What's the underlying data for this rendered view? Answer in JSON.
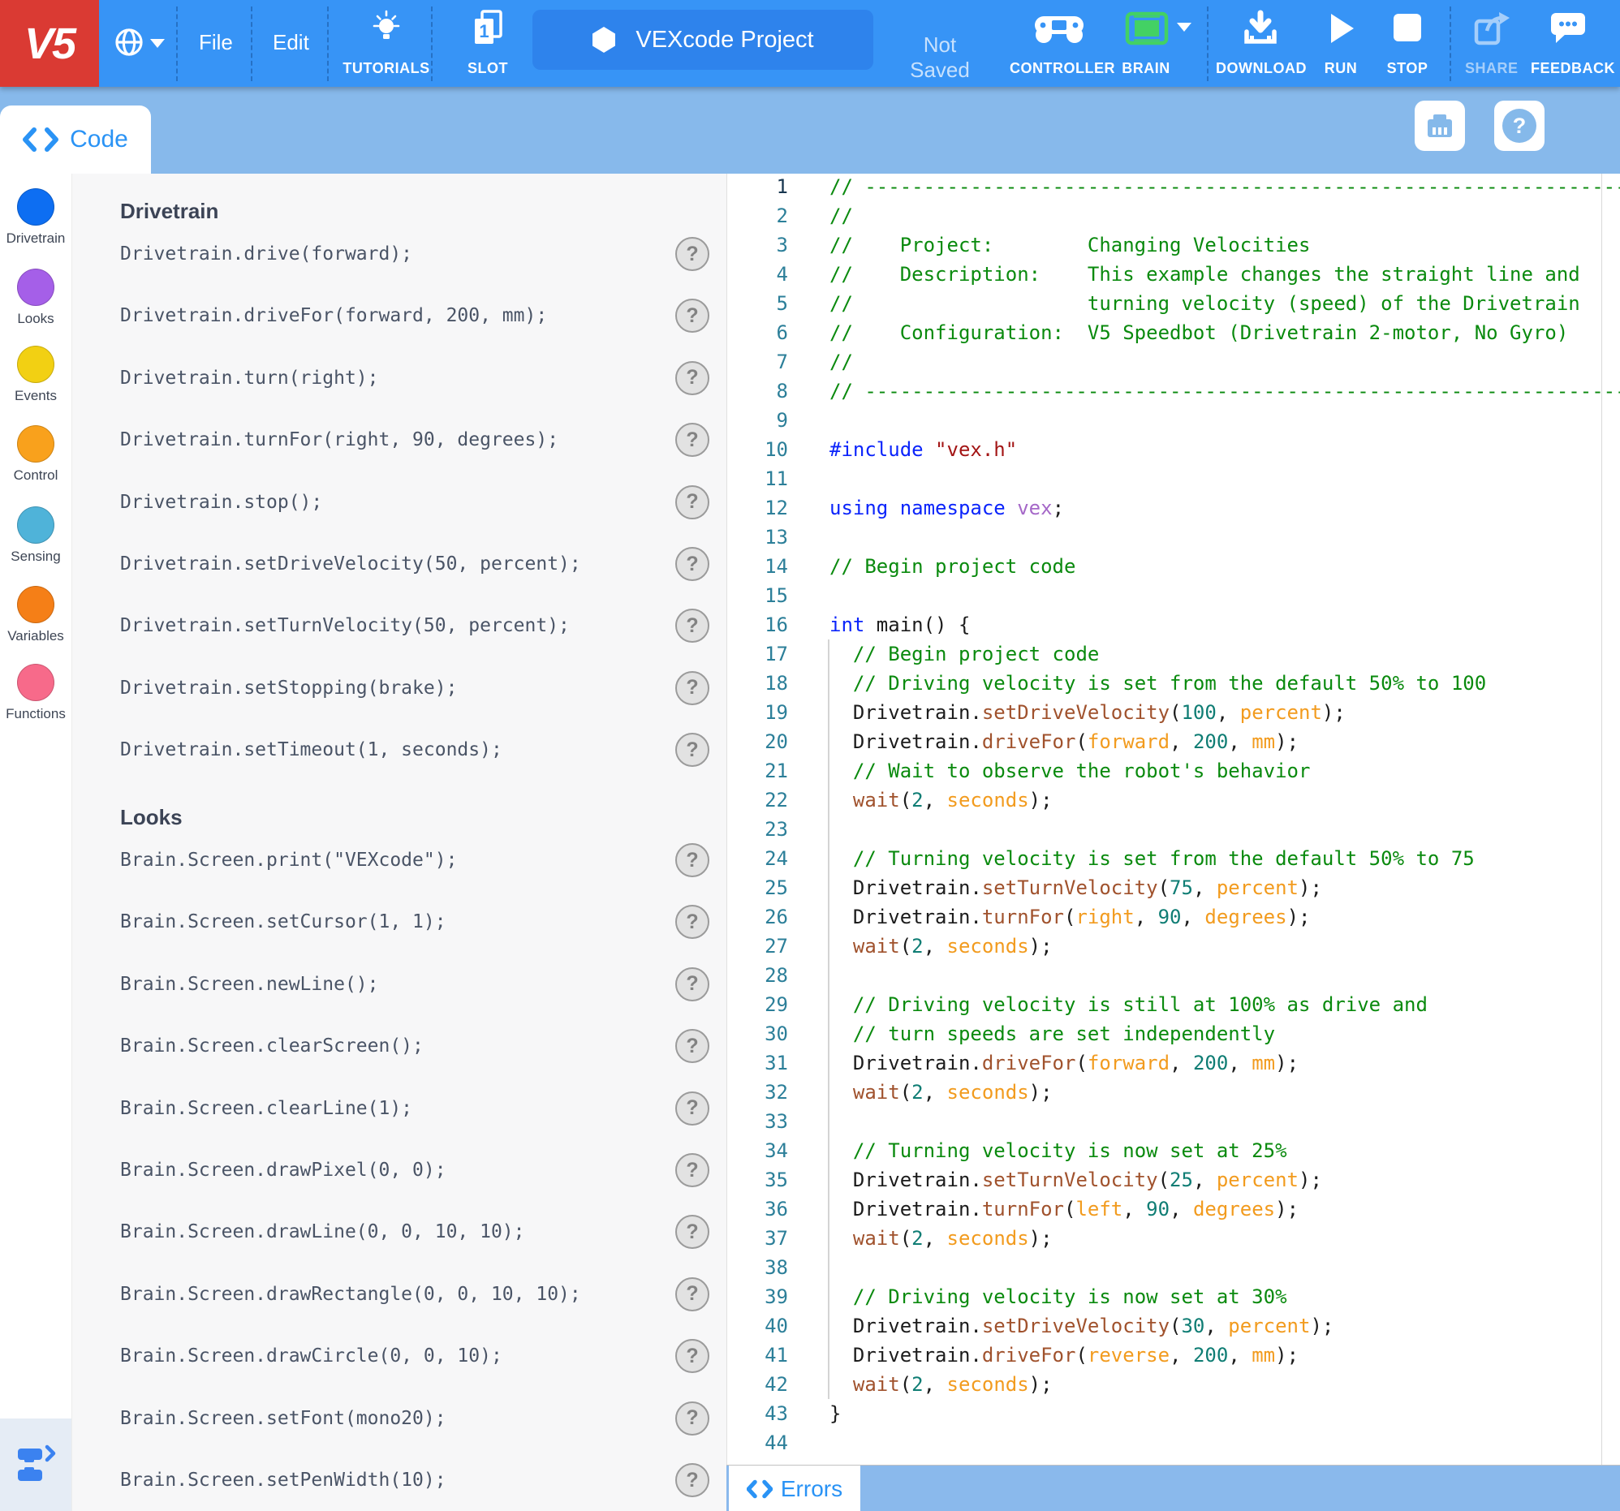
{
  "topbar": {
    "logo_text": "V5",
    "menus": [
      {
        "label": "File"
      },
      {
        "label": "Edit"
      }
    ],
    "tutorials_label": "TUTORIALS",
    "slot_label": "SLOT",
    "slot_number": "1",
    "project_name": "VEXcode Project",
    "save_status": "Not Saved",
    "controller_label": "CONTROLLER",
    "brain_label": "BRAIN",
    "download_label": "DOWNLOAD",
    "run_label": "RUN",
    "stop_label": "STOP",
    "share_label": "SHARE",
    "feedback_label": "FEEDBACK",
    "colors": {
      "bar": "#3794f6",
      "logo_bg": "#da3a33",
      "project_button": "#2e83ec",
      "brain_green": "#43d164"
    }
  },
  "tabbar": {
    "code_label": "Code",
    "help_glyph": "?",
    "background": "#87b9eb",
    "accent": "#2a93f5"
  },
  "sidebar": {
    "items": [
      {
        "label": "Drivetrain",
        "color": "#0d6ef2"
      },
      {
        "label": "Looks",
        "color": "#a55fe8"
      },
      {
        "label": "Events",
        "color": "#f2d013"
      },
      {
        "label": "Control",
        "color": "#f9a11c"
      },
      {
        "label": "Sensing",
        "color": "#4fb3d9"
      },
      {
        "label": "Variables",
        "color": "#f57f17"
      },
      {
        "label": "Functions",
        "color": "#f76a8a"
      }
    ]
  },
  "palette": {
    "help_glyph": "?",
    "sections": [
      {
        "title": "Drivetrain",
        "items": [
          "Drivetrain.drive(forward);",
          "Drivetrain.driveFor(forward, 200, mm);",
          "Drivetrain.turn(right);",
          "Drivetrain.turnFor(right, 90, degrees);",
          "Drivetrain.stop();",
          "Drivetrain.setDriveVelocity(50, percent);",
          "Drivetrain.setTurnVelocity(50, percent);",
          "Drivetrain.setStopping(brake);",
          "Drivetrain.setTimeout(1, seconds);"
        ]
      },
      {
        "title": "Looks",
        "items": [
          "Brain.Screen.print(\"VEXcode\");",
          "Brain.Screen.setCursor(1, 1);",
          "Brain.Screen.newLine();",
          "Brain.Screen.clearScreen();",
          "Brain.Screen.clearLine(1);",
          "Brain.Screen.drawPixel(0, 0);",
          "Brain.Screen.drawLine(0, 0, 10, 10);",
          "Brain.Screen.drawRectangle(0, 0, 10, 10);",
          "Brain.Screen.drawCircle(0, 0, 10);",
          "Brain.Screen.setFont(mono20);",
          "Brain.Screen.setPenWidth(10);"
        ]
      }
    ]
  },
  "editor": {
    "active_line": 1,
    "lines": [
      [
        [
          "c",
          "// ----------------------------------------------------------------------"
        ]
      ],
      [
        [
          "c",
          "//"
        ]
      ],
      [
        [
          "c",
          "//    Project:        Changing Velocities"
        ]
      ],
      [
        [
          "c",
          "//    Description:    This example changes the straight line and"
        ]
      ],
      [
        [
          "c",
          "//                    turning velocity (speed) of the Drivetrain"
        ]
      ],
      [
        [
          "c",
          "//    Configuration:  V5 Speedbot (Drivetrain 2-motor, No Gyro)"
        ]
      ],
      [
        [
          "c",
          "//"
        ]
      ],
      [
        [
          "c",
          "// ----------------------------------------------------------------------"
        ]
      ],
      [],
      [
        [
          "k",
          "#include"
        ],
        [
          "p",
          " "
        ],
        [
          "s",
          "\"vex.h\""
        ]
      ],
      [],
      [
        [
          "k",
          "using"
        ],
        [
          "p",
          " "
        ],
        [
          "k",
          "namespace"
        ],
        [
          "p",
          " "
        ],
        [
          "v",
          "vex"
        ],
        [
          "p",
          ";"
        ]
      ],
      [],
      [
        [
          "c",
          "// Begin project code"
        ]
      ],
      [],
      [
        [
          "k",
          "int"
        ],
        [
          "p",
          " main() {"
        ]
      ],
      [
        [
          "p",
          "  "
        ],
        [
          "c",
          "// Begin project code"
        ]
      ],
      [
        [
          "p",
          "  "
        ],
        [
          "c",
          "// Driving velocity is set from the default 50% to 100"
        ]
      ],
      [
        [
          "p",
          "  Drivetrain."
        ],
        [
          "f",
          "setDriveVelocity"
        ],
        [
          "p",
          "("
        ],
        [
          "d",
          "100"
        ],
        [
          "p",
          ", "
        ],
        [
          "a",
          "percent"
        ],
        [
          "p",
          ");"
        ]
      ],
      [
        [
          "p",
          "  Drivetrain."
        ],
        [
          "f",
          "driveFor"
        ],
        [
          "p",
          "("
        ],
        [
          "a",
          "forward"
        ],
        [
          "p",
          ", "
        ],
        [
          "d",
          "200"
        ],
        [
          "p",
          ", "
        ],
        [
          "a",
          "mm"
        ],
        [
          "p",
          ");"
        ]
      ],
      [
        [
          "p",
          "  "
        ],
        [
          "c",
          "// Wait to observe the robot's behavior"
        ]
      ],
      [
        [
          "p",
          "  "
        ],
        [
          "f",
          "wait"
        ],
        [
          "p",
          "("
        ],
        [
          "d",
          "2"
        ],
        [
          "p",
          ", "
        ],
        [
          "a",
          "seconds"
        ],
        [
          "p",
          ");"
        ]
      ],
      [],
      [
        [
          "p",
          "  "
        ],
        [
          "c",
          "// Turning velocity is set from the default 50% to 75"
        ]
      ],
      [
        [
          "p",
          "  Drivetrain."
        ],
        [
          "f",
          "setTurnVelocity"
        ],
        [
          "p",
          "("
        ],
        [
          "d",
          "75"
        ],
        [
          "p",
          ", "
        ],
        [
          "a",
          "percent"
        ],
        [
          "p",
          ");"
        ]
      ],
      [
        [
          "p",
          "  Drivetrain."
        ],
        [
          "f",
          "turnFor"
        ],
        [
          "p",
          "("
        ],
        [
          "a",
          "right"
        ],
        [
          "p",
          ", "
        ],
        [
          "d",
          "90"
        ],
        [
          "p",
          ", "
        ],
        [
          "a",
          "degrees"
        ],
        [
          "p",
          ");"
        ]
      ],
      [
        [
          "p",
          "  "
        ],
        [
          "f",
          "wait"
        ],
        [
          "p",
          "("
        ],
        [
          "d",
          "2"
        ],
        [
          "p",
          ", "
        ],
        [
          "a",
          "seconds"
        ],
        [
          "p",
          ");"
        ]
      ],
      [],
      [
        [
          "p",
          "  "
        ],
        [
          "c",
          "// Driving velocity is still at 100% as drive and"
        ]
      ],
      [
        [
          "p",
          "  "
        ],
        [
          "c",
          "// turn speeds are set independently"
        ]
      ],
      [
        [
          "p",
          "  Drivetrain."
        ],
        [
          "f",
          "driveFor"
        ],
        [
          "p",
          "("
        ],
        [
          "a",
          "forward"
        ],
        [
          "p",
          ", "
        ],
        [
          "d",
          "200"
        ],
        [
          "p",
          ", "
        ],
        [
          "a",
          "mm"
        ],
        [
          "p",
          ");"
        ]
      ],
      [
        [
          "p",
          "  "
        ],
        [
          "f",
          "wait"
        ],
        [
          "p",
          "("
        ],
        [
          "d",
          "2"
        ],
        [
          "p",
          ", "
        ],
        [
          "a",
          "seconds"
        ],
        [
          "p",
          ");"
        ]
      ],
      [],
      [
        [
          "p",
          "  "
        ],
        [
          "c",
          "// Turning velocity is now set at 25%"
        ]
      ],
      [
        [
          "p",
          "  Drivetrain."
        ],
        [
          "f",
          "setTurnVelocity"
        ],
        [
          "p",
          "("
        ],
        [
          "d",
          "25"
        ],
        [
          "p",
          ", "
        ],
        [
          "a",
          "percent"
        ],
        [
          "p",
          ");"
        ]
      ],
      [
        [
          "p",
          "  Drivetrain."
        ],
        [
          "f",
          "turnFor"
        ],
        [
          "p",
          "("
        ],
        [
          "a",
          "left"
        ],
        [
          "p",
          ", "
        ],
        [
          "d",
          "90"
        ],
        [
          "p",
          ", "
        ],
        [
          "a",
          "degrees"
        ],
        [
          "p",
          ");"
        ]
      ],
      [
        [
          "p",
          "  "
        ],
        [
          "f",
          "wait"
        ],
        [
          "p",
          "("
        ],
        [
          "d",
          "2"
        ],
        [
          "p",
          ", "
        ],
        [
          "a",
          "seconds"
        ],
        [
          "p",
          ");"
        ]
      ],
      [],
      [
        [
          "p",
          "  "
        ],
        [
          "c",
          "// Driving velocity is now set at 30%"
        ]
      ],
      [
        [
          "p",
          "  Drivetrain."
        ],
        [
          "f",
          "setDriveVelocity"
        ],
        [
          "p",
          "("
        ],
        [
          "d",
          "30"
        ],
        [
          "p",
          ", "
        ],
        [
          "a",
          "percent"
        ],
        [
          "p",
          ");"
        ]
      ],
      [
        [
          "p",
          "  Drivetrain."
        ],
        [
          "f",
          "driveFor"
        ],
        [
          "p",
          "("
        ],
        [
          "a",
          "reverse"
        ],
        [
          "p",
          ", "
        ],
        [
          "d",
          "200"
        ],
        [
          "p",
          ", "
        ],
        [
          "a",
          "mm"
        ],
        [
          "p",
          ");"
        ]
      ],
      [
        [
          "p",
          "  "
        ],
        [
          "f",
          "wait"
        ],
        [
          "p",
          "("
        ],
        [
          "d",
          "2"
        ],
        [
          "p",
          ", "
        ],
        [
          "a",
          "seconds"
        ],
        [
          "p",
          ");"
        ]
      ],
      [
        [
          "p",
          "}"
        ]
      ],
      []
    ]
  },
  "bottombar": {
    "errors_label": "Errors"
  }
}
